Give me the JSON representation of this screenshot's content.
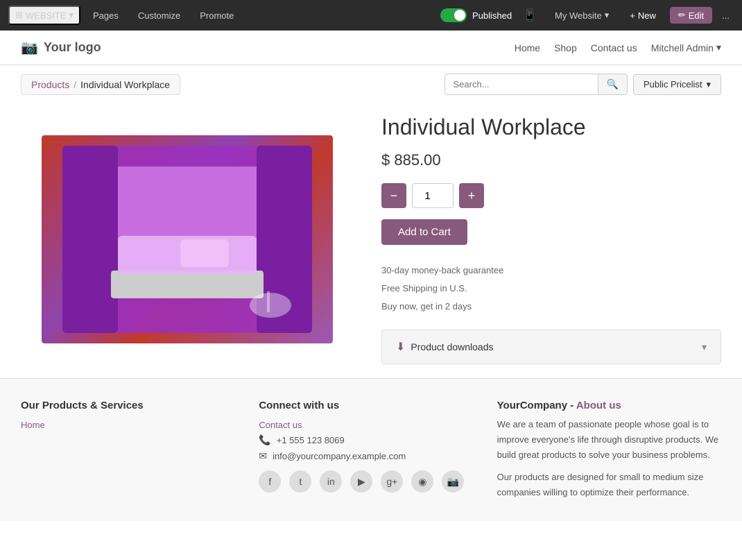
{
  "topnav": {
    "website_label": "WEBSITE",
    "pages_label": "Pages",
    "customize_label": "Customize",
    "promote_label": "Promote",
    "published_label": "Published",
    "mywebsite_label": "My Website",
    "new_label": "New",
    "edit_label": "Edit",
    "more_label": "..."
  },
  "header": {
    "logo_label": "Your logo",
    "nav": {
      "home": "Home",
      "shop": "Shop",
      "contact": "Contact us",
      "admin": "Mitchell Admin"
    }
  },
  "breadcrumb": {
    "products": "Products",
    "current": "Individual Workplace"
  },
  "search": {
    "placeholder": "Search...",
    "pricelist_label": "Public Pricelist"
  },
  "product": {
    "title": "Individual Workplace",
    "price": "$ 885.00",
    "quantity": "1",
    "add_to_cart": "Add to Cart",
    "features": {
      "guarantee": "30-day money-back guarantee",
      "shipping": "Free Shipping in U.S.",
      "delivery": "Buy now, get in 2 days"
    },
    "downloads_label": "Product downloads"
  },
  "footer": {
    "col1": {
      "title": "Our Products & Services",
      "home_link": "Home"
    },
    "col2": {
      "title": "Connect with us",
      "contact_link": "Contact us",
      "phone": "+1 555 123 8069",
      "email": "info@yourcompany.example.com",
      "socials": [
        "f",
        "t",
        "in",
        "▶",
        "g+",
        "◉",
        "📷"
      ]
    },
    "col3": {
      "company": "YourCompany",
      "about_link": "About us",
      "text1": "We are a team of passionate people whose goal is to improve everyone's life through disruptive products. We build great products to solve your business problems.",
      "text2": "Our products are designed for small to medium size companies willing to optimize their performance."
    }
  }
}
